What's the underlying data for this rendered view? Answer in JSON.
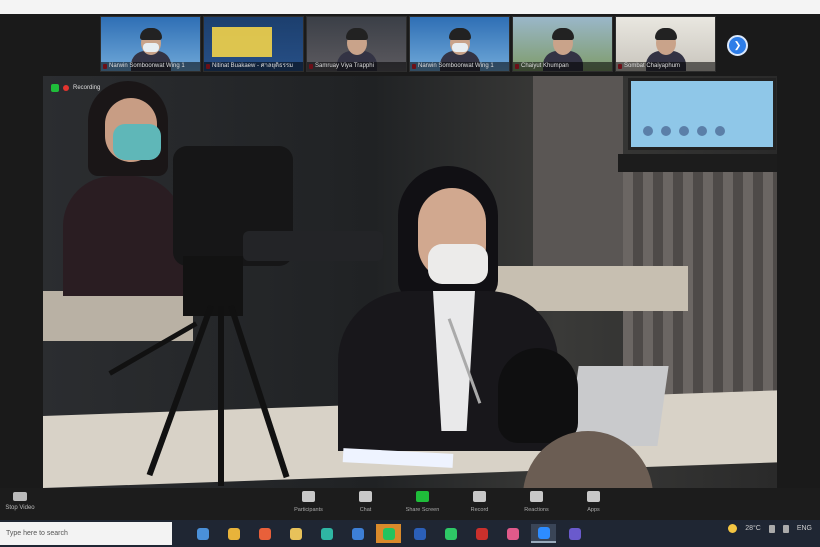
{
  "meeting": {
    "recording_label": "Recording"
  },
  "thumbnails": [
    {
      "name": "Narwin Somboonwat Wing 1",
      "scene": "masked"
    },
    {
      "name": "Nitinat Buakaew - ศาลยุติธรรม",
      "scene": "slide"
    },
    {
      "name": "Samruay Viya Trapphi",
      "scene": "room"
    },
    {
      "name": "Narwin Somboonwat Wing 1",
      "scene": "masked"
    },
    {
      "name": "Chaiyut Khumpan",
      "scene": "outdoor"
    },
    {
      "name": "Sombat Chaiyaphum",
      "scene": "office"
    }
  ],
  "next_page_icon": "chevron-right-icon",
  "toolbar": {
    "left": {
      "label": "Stop Video",
      "icon": "video-icon"
    },
    "items": [
      {
        "label": "Participants",
        "icon": "participants-icon"
      },
      {
        "label": "Chat",
        "icon": "chat-icon"
      },
      {
        "label": "Share Screen",
        "icon": "share-screen-icon"
      },
      {
        "label": "Record",
        "icon": "record-icon"
      },
      {
        "label": "Reactions",
        "icon": "reactions-icon"
      },
      {
        "label": "Apps",
        "icon": "apps-icon"
      }
    ]
  },
  "taskbar": {
    "search_placeholder": "Type here to search",
    "apps": [
      {
        "icon": "file-explorer-icon",
        "color": "#4a90d9"
      },
      {
        "icon": "chrome-icon",
        "color": "#e8b33a"
      },
      {
        "icon": "firefox-icon",
        "color": "#e8603a"
      },
      {
        "icon": "folder-icon",
        "color": "#e8c25a"
      },
      {
        "icon": "edge-icon",
        "color": "#2fb6a3"
      },
      {
        "icon": "mail-icon",
        "color": "#3d7fd6"
      },
      {
        "icon": "line-icon",
        "color": "#22c35e"
      },
      {
        "icon": "word-icon",
        "color": "#2b5fb8"
      },
      {
        "icon": "whatsapp-icon",
        "color": "#2ec866"
      },
      {
        "icon": "pdf-icon",
        "color": "#c9302c"
      },
      {
        "icon": "paint-icon",
        "color": "#e05a8a"
      },
      {
        "icon": "zoom-icon",
        "color": "#2d8cff"
      },
      {
        "icon": "teams-icon",
        "color": "#6a5acd"
      }
    ],
    "tray": {
      "weather": "28°C",
      "language": "ENG",
      "weather_icon": "sun-icon"
    }
  }
}
